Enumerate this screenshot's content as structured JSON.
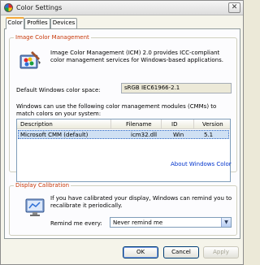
{
  "window": {
    "title": "Color Settings"
  },
  "tabs": [
    {
      "label": "Color",
      "active": true
    },
    {
      "label": "Profiles",
      "active": false
    },
    {
      "label": "Devices",
      "active": false
    }
  ],
  "icm": {
    "group_title": "Image Color Management",
    "description": "Image Color Management (ICM) 2.0 provides ICC-compliant color management services for Windows-based applications.",
    "default_space_label": "Default Windows color space:",
    "default_space_value": "sRGB IEC61966-2.1",
    "cmm_description": "Windows can use the following color management modules (CMMs) to match colors on your system:",
    "columns": [
      "Description",
      "Filename",
      "ID",
      "Version"
    ],
    "rows": [
      {
        "description": "Microsoft CMM (default)",
        "filename": "icm32.dll",
        "id": "Win",
        "version": "5.1"
      }
    ],
    "about_link": "About Windows Color"
  },
  "calibration": {
    "group_title": "Display Calibration",
    "description": "If you have calibrated your display, Windows can remind you to recalibrate it periodically.",
    "remind_label": "Remind me every:",
    "remind_value": "Never remind me"
  },
  "buttons": {
    "ok": "OK",
    "cancel": "Cancel",
    "apply": "Apply"
  },
  "colors": {
    "legend": "#c8390a",
    "link": "#0033cc",
    "tab_highlight": "#f4a93b"
  }
}
